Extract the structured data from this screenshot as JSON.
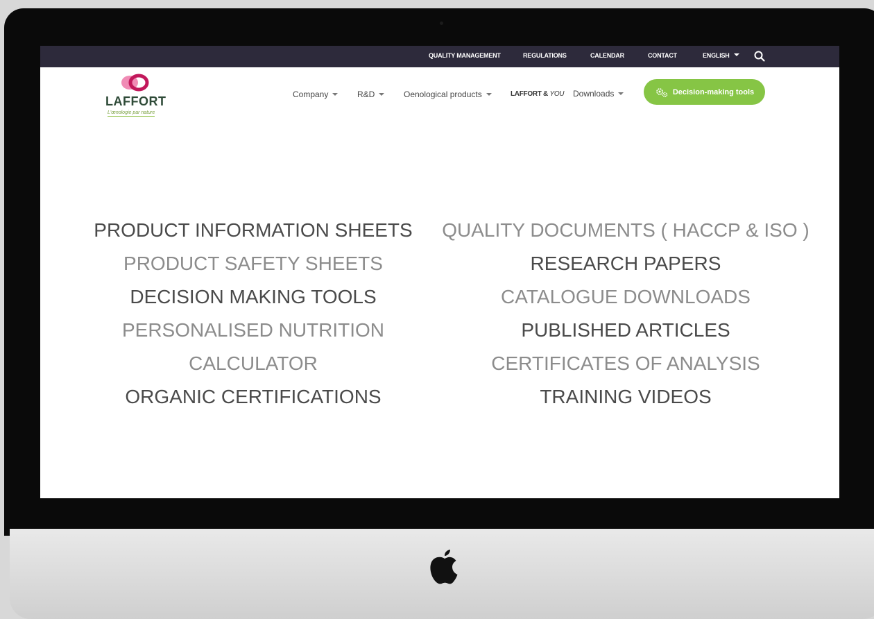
{
  "topbar": {
    "links": [
      "QUALITY MANAGEMENT",
      "REGULATIONS",
      "CALENDAR",
      "CONTACT"
    ],
    "language": "ENGLISH"
  },
  "logo": {
    "wordmark": "LAFFORT",
    "tagline": "L'œnologie par nature"
  },
  "nav": {
    "company": "Company",
    "rnd": "R&D",
    "oenological": "Oenological products",
    "brand_bold": "LAFFORT &",
    "brand_italic": "YOU",
    "downloads": "Downloads",
    "decision_button": "Decision-making tools"
  },
  "links": {
    "left": [
      "PRODUCT INFORMATION SHEETS",
      "PRODUCT SAFETY SHEETS",
      "DECISION MAKING TOOLS",
      "PERSONALISED NUTRITION",
      "CALCULATOR",
      "ORGANIC CERTIFICATIONS"
    ],
    "right": [
      "QUALITY DOCUMENTS ( HACCP & ISO )",
      "RESEARCH PAPERS",
      "CATALOGUE DOWNLOADS",
      "PUBLISHED ARTICLES",
      "CERTIFICATES OF ANALYSIS",
      "TRAINING VIDEOS"
    ]
  },
  "colors": {
    "topbar": "#2d2a3b",
    "accent_green": "#86c545",
    "logo_pink": "#e85f98",
    "logo_magenta": "#c2185b",
    "text_dark": "#4a4a4a",
    "text_light": "#8c8c8c"
  },
  "icons": [
    "search-icon",
    "gears-icon",
    "caret-down-icon",
    "apple-logo"
  ]
}
